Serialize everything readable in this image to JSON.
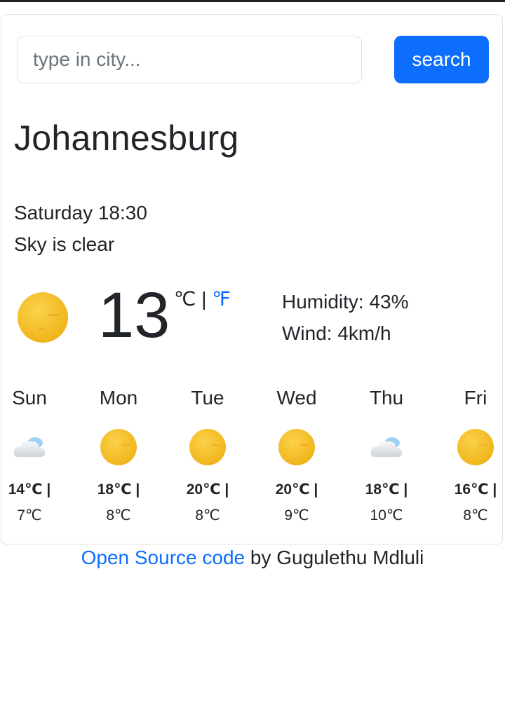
{
  "search": {
    "placeholder": "type in city...",
    "button_label": "search"
  },
  "current": {
    "city": "Johannesburg",
    "datetime": "Saturday 18:30",
    "description": "Sky is clear",
    "icon": "sun-icon",
    "temperature": "13",
    "unit_celsius": "℃",
    "unit_separator": " | ",
    "unit_fahrenheit": "℉",
    "humidity": "Humidity: 43%",
    "wind": "Wind: 4km/h"
  },
  "forecast": [
    {
      "day": "Sun",
      "icon": "cloud-icon",
      "high": "14℃ |",
      "low": "7℃"
    },
    {
      "day": "Mon",
      "icon": "sun-icon",
      "high": "18℃ |",
      "low": "8℃"
    },
    {
      "day": "Tue",
      "icon": "sun-icon",
      "high": "20℃ |",
      "low": "8℃"
    },
    {
      "day": "Wed",
      "icon": "sun-icon",
      "high": "20℃ |",
      "low": "9℃"
    },
    {
      "day": "Thu",
      "icon": "cloud-icon",
      "high": "18℃ |",
      "low": "10℃"
    },
    {
      "day": "Fri",
      "icon": "sun-icon",
      "high": "16℃ |",
      "low": "8℃"
    }
  ],
  "footer": {
    "link_text": "Open Source code",
    "suffix": " by Gugulethu Mdluli"
  },
  "colors": {
    "accent": "#0d6efd",
    "sun": "#f4bd22",
    "text": "#212529"
  }
}
